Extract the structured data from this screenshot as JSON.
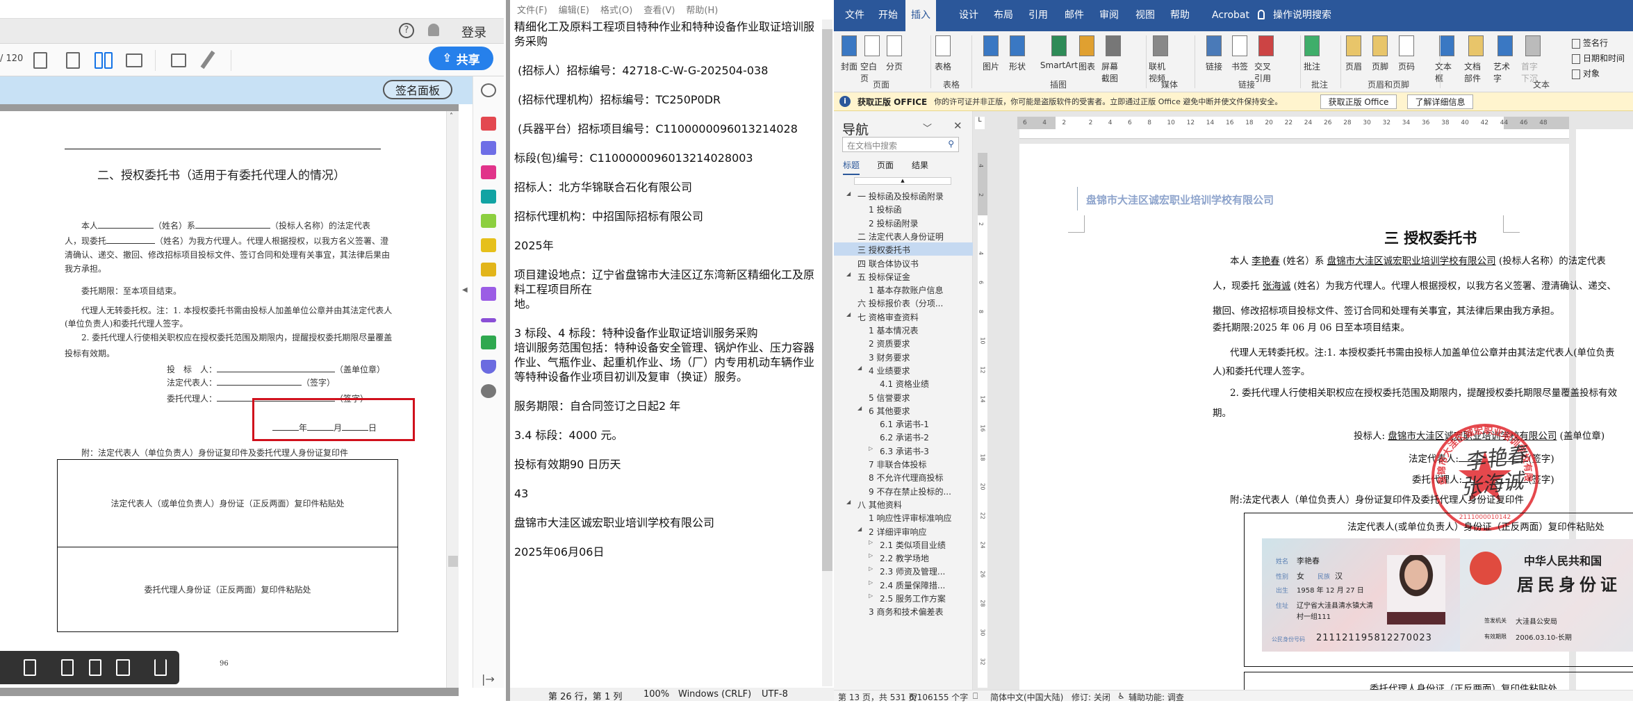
{
  "pdf": {
    "help_icon": "question-circle-icon",
    "login": "登录",
    "page_total": "/ 120",
    "share": "共享",
    "sign_panel": "签名面板",
    "doc": {
      "title": "二、授权委托书（适用于有委托代理人的情况）",
      "p1a": "本人",
      "p1b": "（姓名）系",
      "p1c": "（投标人名称）的法定代表",
      "p2a": "人，现委托",
      "p2b": "（姓名）为我方代理人。代理人根据授权，以我方名义签署、澄",
      "p3": "清确认、递交、撤回、修改招标项目投标文件、签订合同和处理有关事宜，其法律后果由",
      "p4": "我方承担。",
      "p5": "委托期限：至本项目结束。",
      "p6": "代理人无转委托权。注：1. 本授权委托书需由投标人加盖单位公章并由其法定代表人",
      "p7": "(单位负责人)和委托代理人签字。",
      "p8": "2. 委托代理人行使相关职权应在授权委托范围及期限内，提醒授权委托期限尽量覆盖",
      "p9": "投标有效期。",
      "bidder": "投　标　人：",
      "bidder_suffix": "（盖单位章）",
      "legal_rep": "法定代表人：",
      "legal_rep_suffix": "（签字）",
      "agent": "委托代理人：",
      "agent_suffix": "（签字）",
      "year": "年",
      "month": "月",
      "day": "日",
      "attach": "附：法定代表人（单位负责人）身份证复印件及委托代理人身份证复印件",
      "box1": "法定代表人（或单位负责人）身份证（正反两面）复印件粘贴处",
      "box2": "委托代理人身份证（正反两面）复印件粘贴处",
      "page_number": "96"
    }
  },
  "notepad": {
    "menu": [
      "文件(F)",
      "编辑(E)",
      "格式(O)",
      "查看(V)",
      "帮助(H)"
    ],
    "paragraphs": [
      "精细化工及原料工程项目特种作业和特种设备作业取证培训服\n务采购",
      " (招标人）招标编号：42718-C-W-G-202504-038",
      " (招标代理机构）招标编号：TC250P0DR",
      " (兵器平台）招标项目编号：C1100000096013214028",
      "标段(包)编号：C1100000096013214028003",
      "招标人：北方华锦联合石化有限公司",
      "招标代理机构：中招国际招标有限公司",
      "2025年",
      "项目建设地点：辽宁省盘锦市大洼区辽东湾新区精细化工及原\n料工程项目所在\n地。",
      "3 标段、4 标段：特种设备作业取证培训服务采购\n培训服务范围包括：特种设备安全管理、锅炉作业、压力容器\n作业、气瓶作业、起重机作业、场（厂）内专用机动车辆作业\n等特种设备作业项目初训及复审（换证）服务。",
      "服务期限：自合同签订之日起2 年",
      "3.4 标段：4000 元。",
      "投标有效期90 日历天",
      "43",
      "盘锦市大洼区诚宏职业培训学校有限公司",
      "2025年06月06日"
    ],
    "status": {
      "position": "第 26 行，第 1 列",
      "zoom": "100%",
      "line_ending": "Windows (CRLF)",
      "encoding": "UTF-8"
    }
  },
  "word": {
    "tabs": [
      "文件",
      "开始",
      "插入",
      "设计",
      "布局",
      "引用",
      "邮件",
      "审阅",
      "视图",
      "帮助",
      "Acrobat"
    ],
    "active_tab": "插入",
    "tell_me": "操作说明搜索",
    "ribbon": {
      "buttons": [
        "封面",
        "空白页",
        "分页",
        "表格",
        "图片",
        "形状",
        "SmartArt",
        "图表",
        "屏幕截图",
        "联机视频",
        "链接",
        "书签",
        "交叉引用",
        "批注",
        "页眉",
        "页脚",
        "页码",
        "文本框",
        "文档部件",
        "艺术字",
        "首字下沉"
      ],
      "small_buttons": [
        "签名行",
        "日期和时间",
        "对象"
      ],
      "groups": [
        "页面",
        "表格",
        "插图",
        "媒体",
        "链接",
        "批注",
        "页眉和页脚",
        "文本"
      ]
    },
    "notice": {
      "title": "获取正版 OFFICE",
      "message": "你的许可证并非正版，你可能是盗版软件的受害者。立即通过正版 Office 避免中断并使文件保持安全。",
      "btn_get": "获取正版 Office",
      "btn_learn": "了解详细信息"
    },
    "nav": {
      "title": "导航",
      "search_placeholder": "在文档中搜索",
      "tabs": [
        "标题",
        "页面",
        "结果"
      ],
      "items": [
        {
          "label": "一 投标函及投标函附录",
          "level": 0,
          "toggle": "expanded"
        },
        {
          "label": "1 投标函",
          "level": 1,
          "toggle": ""
        },
        {
          "label": "2 投标函附录",
          "level": 1,
          "toggle": ""
        },
        {
          "label": "二 法定代表人身份证明",
          "level": 0,
          "toggle": ""
        },
        {
          "label": "三  授权委托书",
          "level": 0,
          "toggle": "",
          "selected": true
        },
        {
          "label": "四 联合体协议书",
          "level": 0,
          "toggle": ""
        },
        {
          "label": "五 投标保证金",
          "level": 0,
          "toggle": "expanded"
        },
        {
          "label": "1 基本存款账户信息",
          "level": 1,
          "toggle": ""
        },
        {
          "label": "六 投标报价表（分项...",
          "level": 0,
          "toggle": ""
        },
        {
          "label": "七 资格审查资料",
          "level": 0,
          "toggle": "expanded"
        },
        {
          "label": "1 基本情况表",
          "level": 1,
          "toggle": ""
        },
        {
          "label": "2 资质要求",
          "level": 1,
          "toggle": ""
        },
        {
          "label": "3 财务要求",
          "level": 1,
          "toggle": ""
        },
        {
          "label": "4 业绩要求",
          "level": 1,
          "toggle": "expanded"
        },
        {
          "label": "4.1 资格业绩",
          "level": 2,
          "toggle": ""
        },
        {
          "label": "5 信誉要求",
          "level": 1,
          "toggle": ""
        },
        {
          "label": "6 其他要求",
          "level": 1,
          "toggle": "expanded"
        },
        {
          "label": "6.1 承诺书-1",
          "level": 2,
          "toggle": ""
        },
        {
          "label": "6.2 承诺书-2",
          "level": 2,
          "toggle": ""
        },
        {
          "label": "6.3 承诺书-3",
          "level": 2,
          "toggle": "collapsed"
        },
        {
          "label": "7 非联合体投标",
          "level": 1,
          "toggle": ""
        },
        {
          "label": "8 不允许代理商投标",
          "level": 1,
          "toggle": ""
        },
        {
          "label": "9 不存在禁止投标的...",
          "level": 1,
          "toggle": ""
        },
        {
          "label": "八 其他资料",
          "level": 0,
          "toggle": "expanded"
        },
        {
          "label": "1 响应性评审标准响应",
          "level": 1,
          "toggle": ""
        },
        {
          "label": "2 详细评审响应",
          "level": 1,
          "toggle": "expanded"
        },
        {
          "label": "2.1 类似项目业绩",
          "level": 2,
          "toggle": "collapsed"
        },
        {
          "label": "2.2 教学场地",
          "level": 2,
          "toggle": "collapsed"
        },
        {
          "label": "2.3 师资及管理...",
          "level": 2,
          "toggle": "collapsed"
        },
        {
          "label": "2.4 质量保障措...",
          "level": 2,
          "toggle": "collapsed"
        },
        {
          "label": "2.5 服务工作方案",
          "level": 2,
          "toggle": "collapsed"
        },
        {
          "label": "3 商务和技术偏差表",
          "level": 1,
          "toggle": ""
        }
      ]
    },
    "ruler_ticks": [
      "6",
      "4",
      "2",
      "2",
      "4",
      "6",
      "8",
      "10",
      "12",
      "14",
      "16",
      "18",
      "20",
      "22",
      "24",
      "26",
      "28",
      "30",
      "32",
      "34",
      "36",
      "38",
      "40",
      "42",
      "44",
      "46",
      "48"
    ],
    "vruler_ticks": [
      "4",
      "2",
      "2",
      "4",
      "6",
      "8",
      "10",
      "12",
      "14",
      "16",
      "18",
      "20",
      "22",
      "24",
      "26",
      "28",
      "30",
      "32"
    ],
    "doc": {
      "header": "盘锦市大洼区诚宏职业培训学校有限公司",
      "title": "三  授权委托书",
      "l1a": "本人 ",
      "legal_name": "李艳春",
      "l1b": " (姓名）系 ",
      "company": "盘锦市大洼区诚宏职业培训学校有限公司",
      "l1c": " (投标人名称）的法定代表",
      "l2a": "人，现委托 ",
      "agent_name": "张海诚",
      "l2b": " (姓名）为我方代理人。代理人根据授权，以我方名义签署、澄清确认、递交、",
      "l3": "撤回、修改招标项目投标文件、签订合同和处理有关事宜，其法律后果由我方承担。",
      "l4": "委托期限:2025 年 06 月 06 日至本项目结束。",
      "l5": "代理人无转委托权。注:1. 本授权委托书需由投标人加盖单位公章并由其法定代表人(单位负责",
      "l6": "人)和委托代理人签字。",
      "l7": "2. 委托代理人行使相关职权应在授权委托范围及期限内，提醒授权委托期限尽量覆盖投标有效",
      "l8": "期。",
      "bidder": "投标人: ",
      "bidder_suffix": " (盖单位章)",
      "legal_rep": "法定代表人:",
      "agent": "委托代理人:",
      "sign_suffix": "(签字)",
      "attach": "附:法定代表人（单位负责人）身份证复印件及委托代理人身份证复印件",
      "box1": "法定代表人(或单位负责人）身份证（正反两面）复印件粘贴处",
      "box2": "委托代理人身份证（正反两面）复印件粘贴处",
      "stamp_text": "盘锦市大洼区诚宏职业培训学校有限公司",
      "stamp_number": "2111000010142",
      "signature_legal": "李艳春",
      "signature_agent": "张海诚"
    },
    "id_card": {
      "name_label": "姓名",
      "name": "李艳春",
      "sex_label": "性别",
      "sex": "女",
      "ethnic_label": "民族",
      "ethnic": "汉",
      "birth_label": "出生",
      "birth": "1958 年 12 月 27 日",
      "addr_label": "住址",
      "addr1": "辽宁省大洼县清水镇大清",
      "addr2": "村一组111",
      "id_label": "公民身份号码",
      "id_number": "211121195812270023",
      "country": "中华人民共和国",
      "card_title": "居民身份证",
      "authority_label": "签发机关",
      "authority": "大洼县公安局",
      "valid_label": "有效期限",
      "valid": "2006.03.10-长期"
    },
    "status": {
      "page": "第 13 页，共 531 页",
      "words": "6/106155 个字",
      "language": "简体中文(中国大陆)",
      "track": "修订: 关闭",
      "accessibility": "辅助功能: 调查"
    }
  },
  "colors": {
    "word_blue": "#2b579a",
    "share_blue": "#2680eb",
    "highlight_red": "#d0101c",
    "stamp_red": "#e0282e"
  }
}
